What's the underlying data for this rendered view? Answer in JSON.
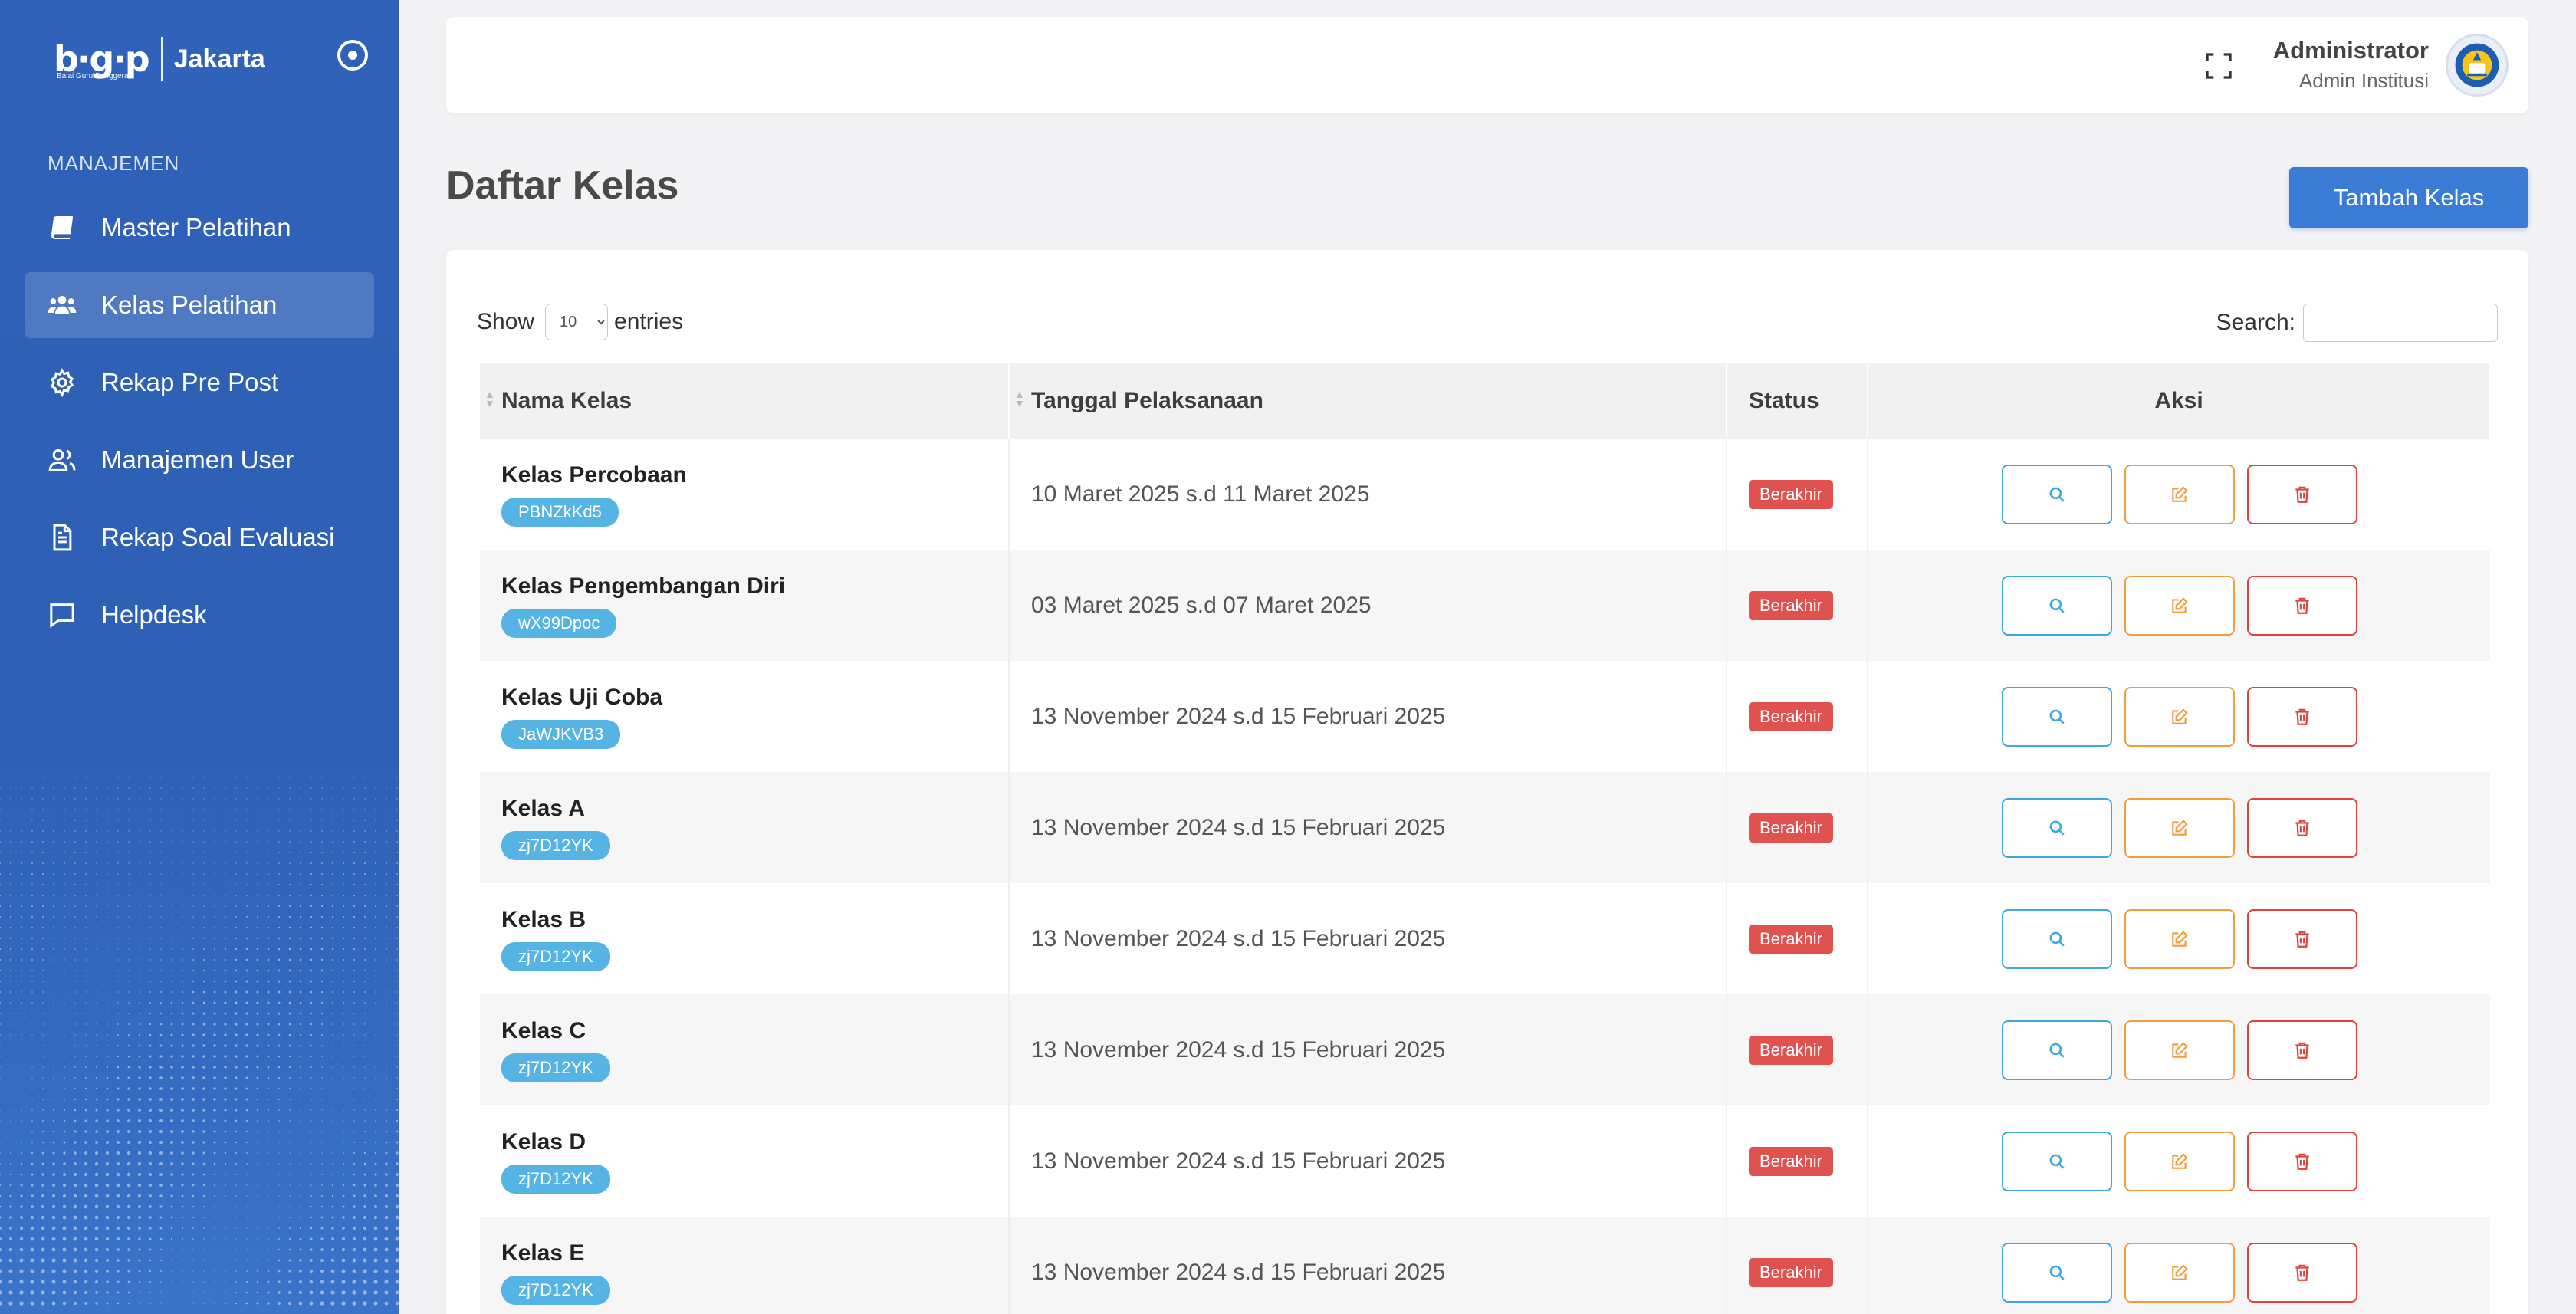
{
  "brand": {
    "logo": "b·g·p",
    "logo_sub": "Balai Guru Penggerak",
    "city": "Jakarta"
  },
  "sidebar": {
    "heading": "MANAJEMEN",
    "items": [
      {
        "label": "Master Pelatihan",
        "icon": "book-icon",
        "active": false
      },
      {
        "label": "Kelas Pelatihan",
        "icon": "users-icon",
        "active": true
      },
      {
        "label": "Rekap Pre Post",
        "icon": "gear-icon",
        "active": false
      },
      {
        "label": "Manajemen User",
        "icon": "user-group-icon",
        "active": false
      },
      {
        "label": "Rekap Soal Evaluasi",
        "icon": "document-icon",
        "active": false
      },
      {
        "label": "Helpdesk",
        "icon": "chat-icon",
        "active": false
      }
    ]
  },
  "header": {
    "user_name": "Administrator",
    "user_role": "Admin Institusi"
  },
  "page": {
    "title": "Daftar Kelas",
    "add_button": "Tambah Kelas"
  },
  "table_controls": {
    "show_label": "Show",
    "entries_value": "10",
    "entries_label": "entries",
    "search_label": "Search:"
  },
  "table": {
    "columns": [
      "Nama Kelas",
      "Tanggal Pelaksanaan",
      "Status",
      "Aksi"
    ],
    "rows": [
      {
        "name": "Kelas Percobaan",
        "code": "PBNZkKd5",
        "date": "10 Maret 2025 s.d 11 Maret 2025",
        "status": "Berakhir"
      },
      {
        "name": "Kelas Pengembangan Diri",
        "code": "wX99Dpoc",
        "date": "03 Maret 2025 s.d 07 Maret 2025",
        "status": "Berakhir"
      },
      {
        "name": "Kelas Uji Coba",
        "code": "JaWJKVB3",
        "date": "13 November 2024 s.d 15 Februari 2025",
        "status": "Berakhir"
      },
      {
        "name": "Kelas A",
        "code": "zj7D12YK",
        "date": "13 November 2024 s.d 15 Februari 2025",
        "status": "Berakhir"
      },
      {
        "name": "Kelas B",
        "code": "zj7D12YK",
        "date": "13 November 2024 s.d 15 Februari 2025",
        "status": "Berakhir"
      },
      {
        "name": "Kelas C",
        "code": "zj7D12YK",
        "date": "13 November 2024 s.d 15 Februari 2025",
        "status": "Berakhir"
      },
      {
        "name": "Kelas D",
        "code": "zj7D12YK",
        "date": "13 November 2024 s.d 15 Februari 2025",
        "status": "Berakhir"
      },
      {
        "name": "Kelas E",
        "code": "zj7D12YK",
        "date": "13 November 2024 s.d 15 Februari 2025",
        "status": "Berakhir"
      }
    ]
  },
  "colors": {
    "sidebar": "#2f62b8",
    "primary": "#3a7bd5",
    "info": "#56b4e4",
    "danger": "#e0524f",
    "warning": "#f39c3d"
  }
}
